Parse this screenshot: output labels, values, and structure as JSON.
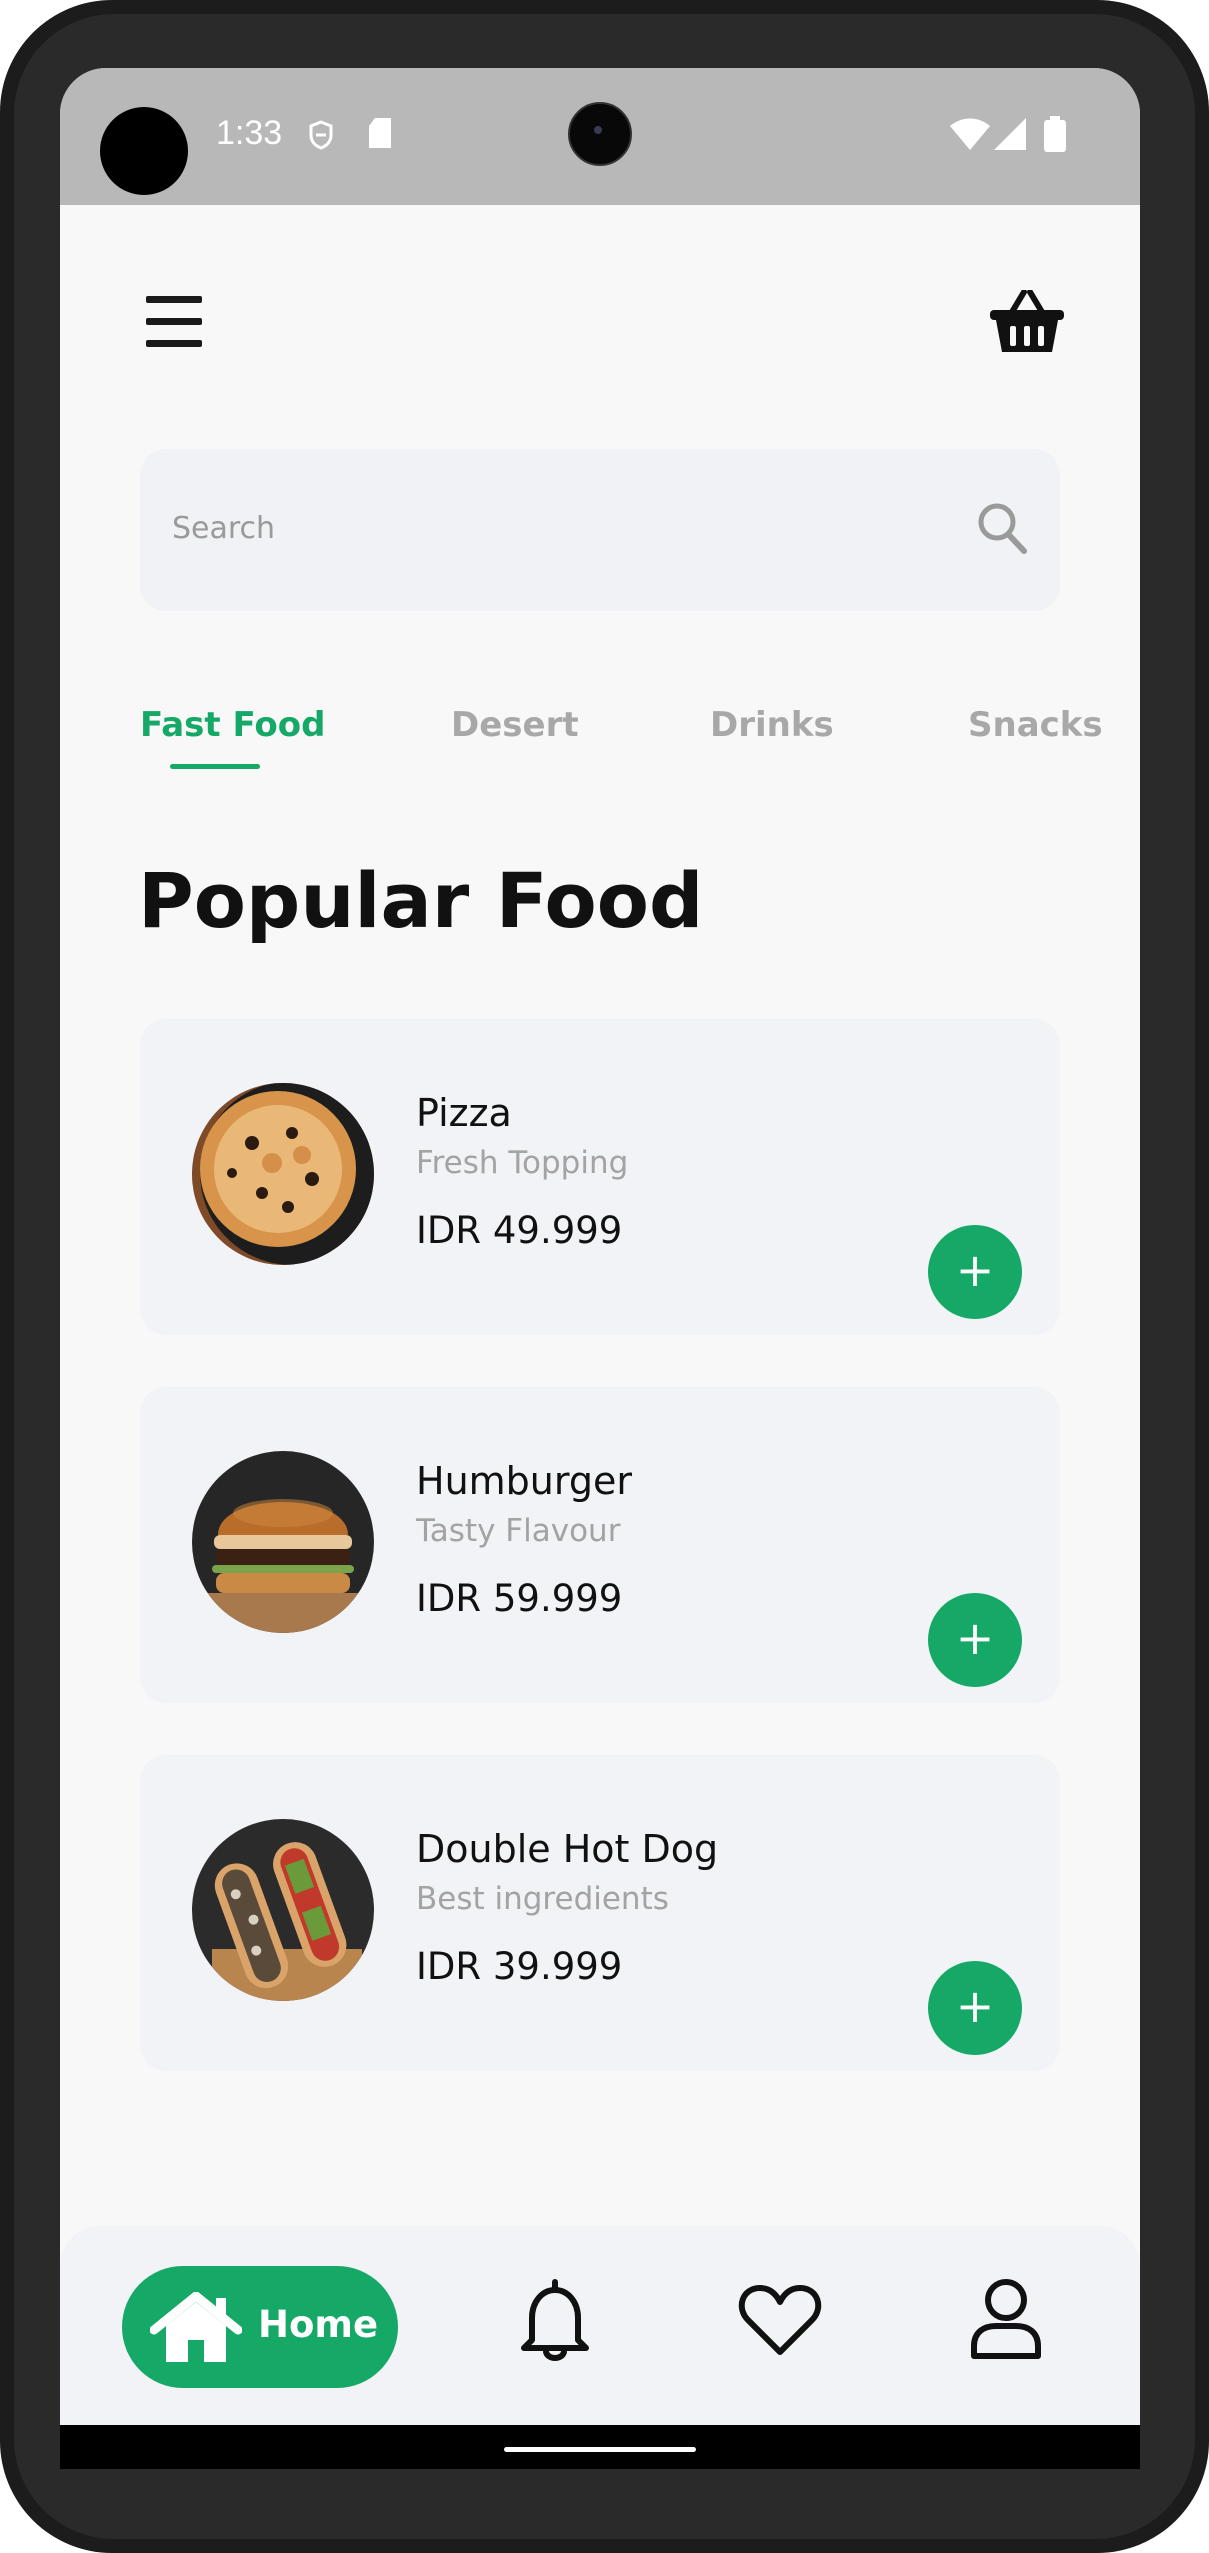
{
  "status_bar": {
    "time": "1:33"
  },
  "search": {
    "placeholder": "Search"
  },
  "tabs": [
    {
      "label": "Fast Food",
      "active": true
    },
    {
      "label": "Desert",
      "active": false
    },
    {
      "label": "Drinks",
      "active": false
    },
    {
      "label": "Snacks",
      "active": false
    }
  ],
  "section_title": "Popular Food",
  "foods": [
    {
      "name": "Pizza",
      "subtitle": "Fresh Topping",
      "price": "IDR 49.999",
      "add_label": "+"
    },
    {
      "name": "Humburger",
      "subtitle": "Tasty Flavour",
      "price": "IDR 59.999",
      "add_label": "+"
    },
    {
      "name": "Double Hot Dog",
      "subtitle": "Best ingredients",
      "price": "IDR 39.999",
      "add_label": "+"
    }
  ],
  "bottom_nav": {
    "home_label": "Home",
    "items": [
      "home-icon",
      "bell-icon",
      "heart-icon",
      "user-icon"
    ]
  },
  "colors": {
    "accent": "#15a866",
    "background": "#f8f8f8",
    "card": "#f2f3f7",
    "status_bar": "#b8b8b8"
  }
}
